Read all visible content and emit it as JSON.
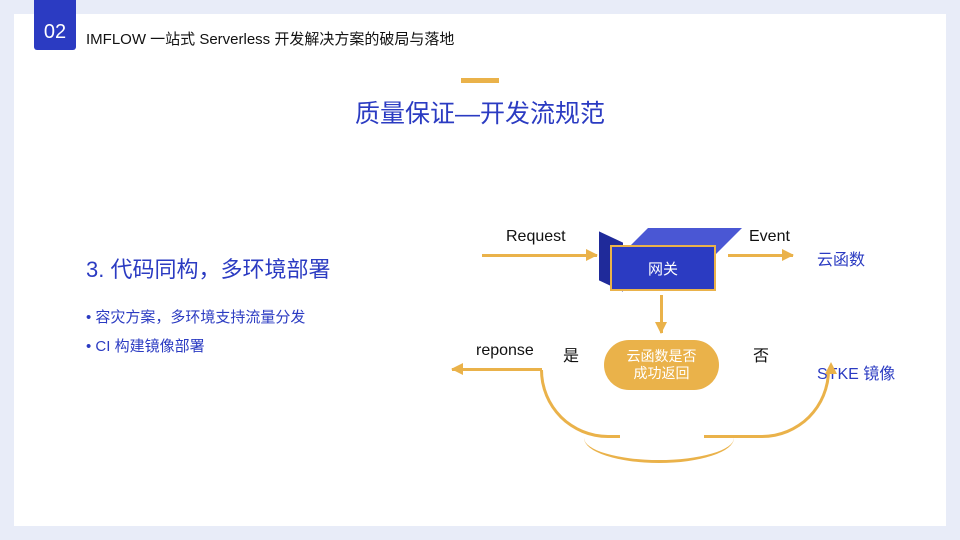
{
  "header": {
    "section_number": "02",
    "title": "IMFLOW 一站式 Serverless 开发解决方案的破局与落地"
  },
  "main_title": "质量保证—开发流规范",
  "subtitle": "3. 代码同构，多环境部署",
  "bullets": [
    "容灾方案，多环境支持流量分发",
    "CI 构建镜像部署"
  ],
  "diagram": {
    "gateway": "网关",
    "request_label": "Request",
    "event_label": "Event",
    "cloud_function": "云函数",
    "decision_line1": "云函数是否",
    "decision_line2": "成功返回",
    "yes_label": "是",
    "no_label": "否",
    "response_label": "reponse",
    "stke_label": "STKE 镜像"
  }
}
